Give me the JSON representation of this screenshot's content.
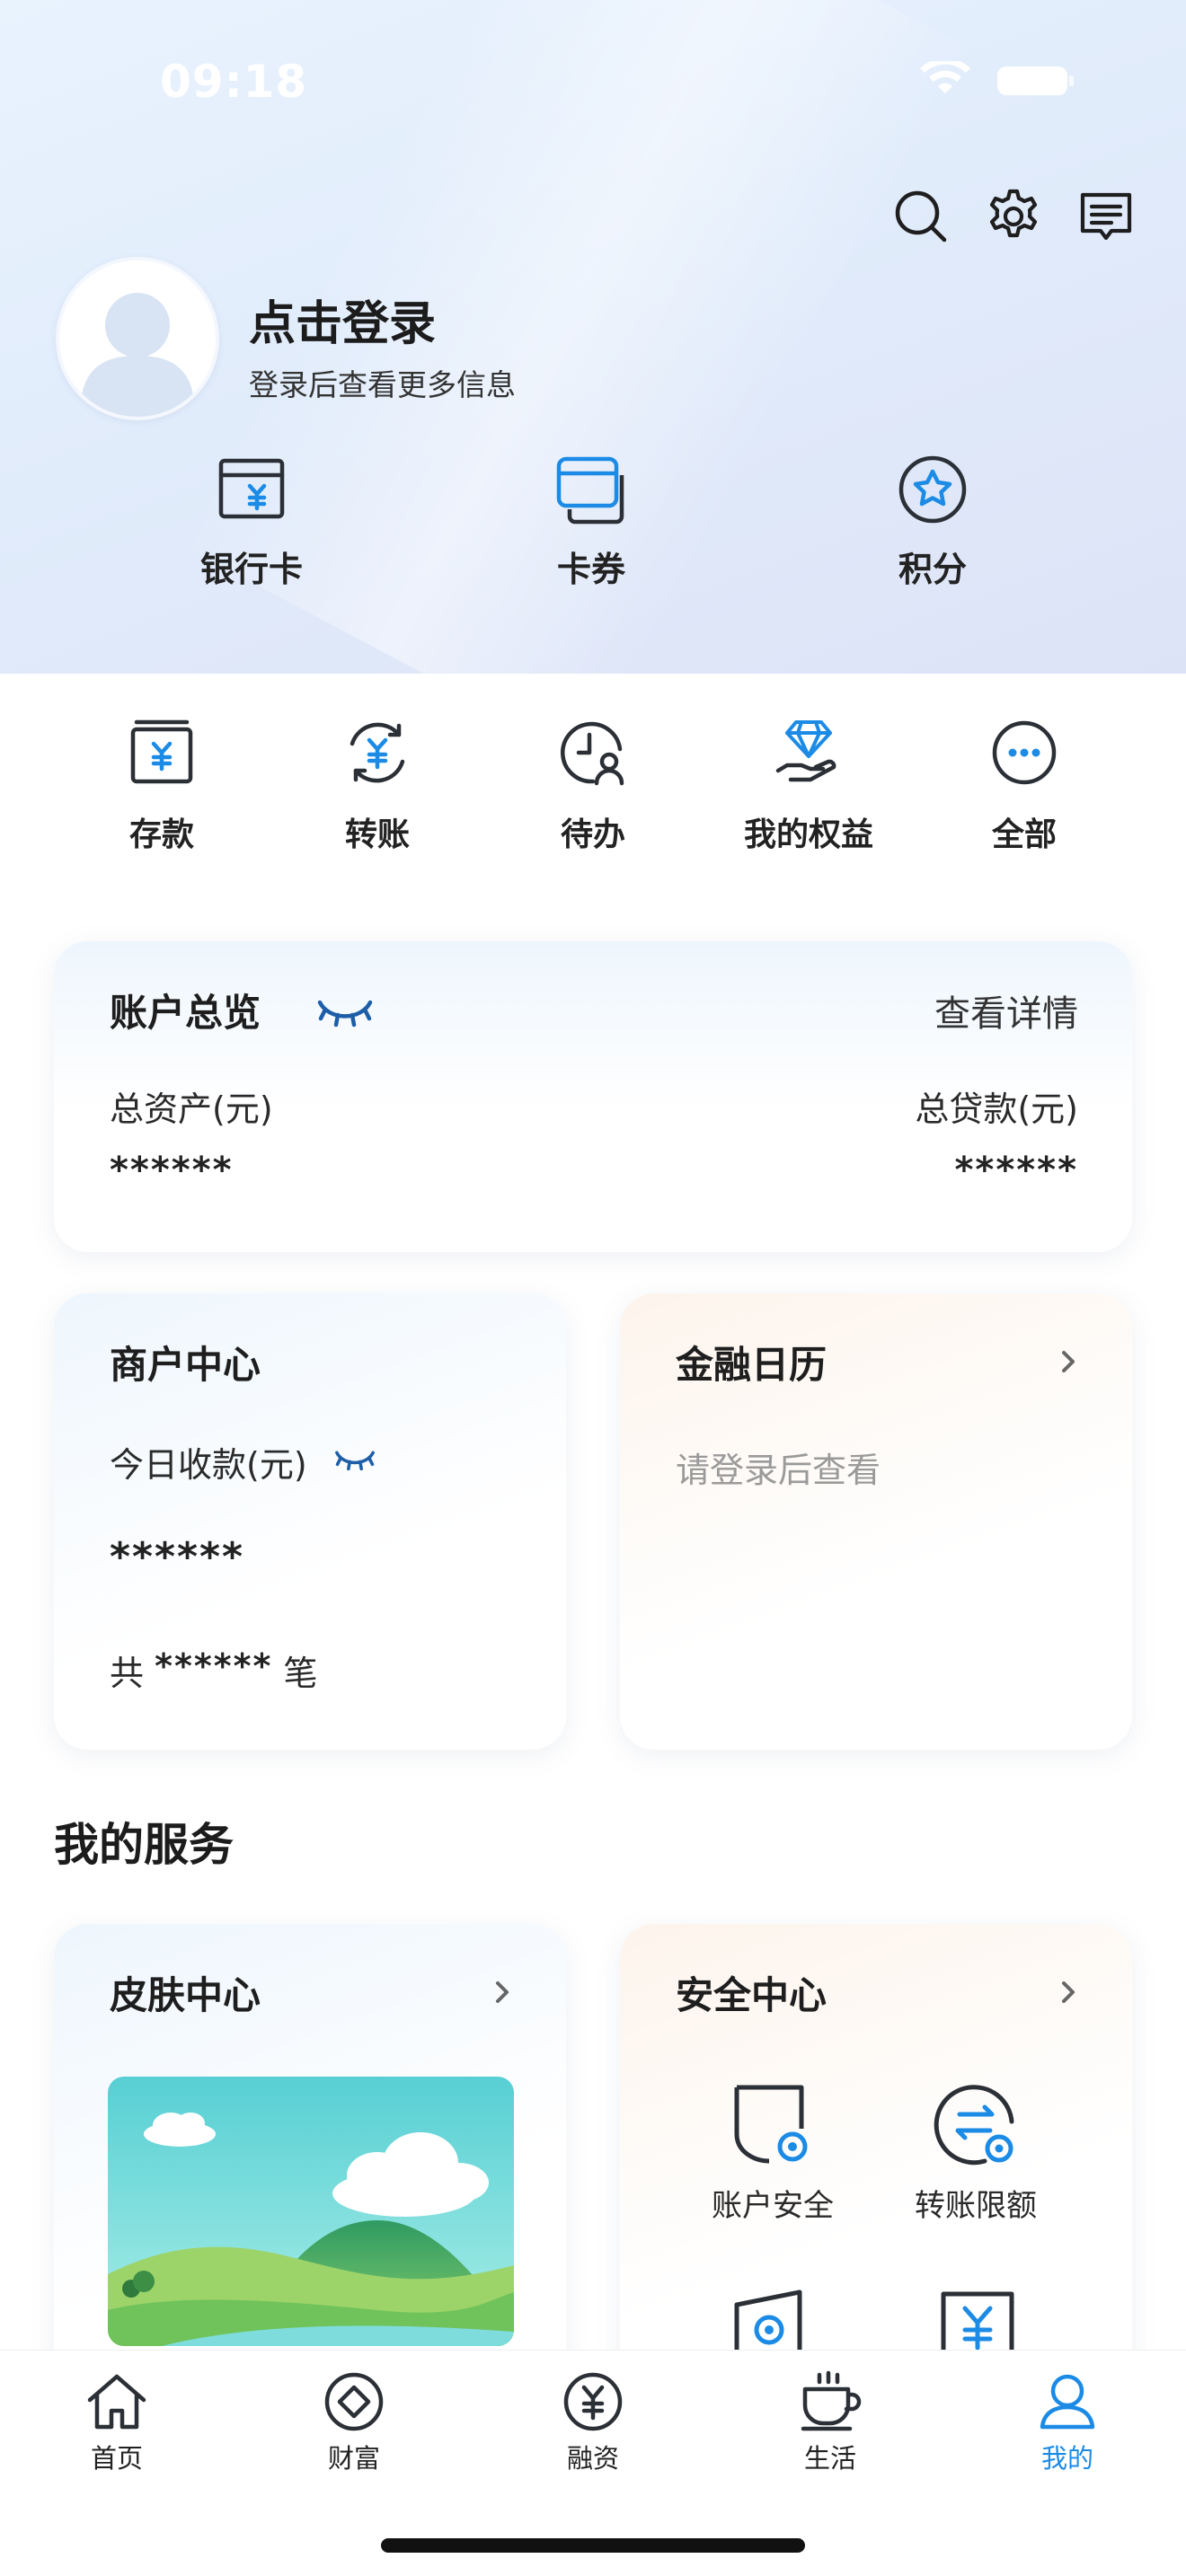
{
  "status_bar": {
    "time": "09:18"
  },
  "header": {
    "actions": [
      {
        "name": "search-icon"
      },
      {
        "name": "settings-icon"
      },
      {
        "name": "message-icon"
      }
    ],
    "profile": {
      "title": "点击登录",
      "subtitle": "登录后查看更多信息"
    },
    "shortcuts": [
      {
        "label": "银行卡",
        "icon": "bank-card-icon"
      },
      {
        "label": "卡券",
        "icon": "coupon-icon"
      },
      {
        "label": "积分",
        "icon": "points-star-icon"
      }
    ]
  },
  "quick_actions": [
    {
      "label": "存款",
      "icon": "deposit-icon"
    },
    {
      "label": "转账",
      "icon": "transfer-icon"
    },
    {
      "label": "待办",
      "icon": "todo-icon"
    },
    {
      "label": "我的权益",
      "icon": "benefits-diamond-icon"
    },
    {
      "label": "全部",
      "icon": "more-icon"
    }
  ],
  "account_overview": {
    "title": "账户总览",
    "detail_link": "查看详情",
    "total_assets_label": "总资产(元)",
    "total_assets_value": "******",
    "total_loans_label": "总贷款(元)",
    "total_loans_value": "******"
  },
  "merchant_center": {
    "title": "商户中心",
    "today_label": "今日收款(元)",
    "today_value": "******",
    "count_prefix": "共",
    "count_value": "******",
    "count_suffix": "笔"
  },
  "finance_calendar": {
    "title": "金融日历",
    "hint": "请登录后查看"
  },
  "my_services": {
    "section_title": "我的服务",
    "skin_center": {
      "title": "皮肤中心"
    },
    "security_center": {
      "title": "安全中心",
      "items": [
        {
          "label": "账户安全",
          "icon": "account-security-icon"
        },
        {
          "label": "转账限额",
          "icon": "transfer-limit-icon"
        }
      ]
    }
  },
  "tab_bar": {
    "tabs": [
      {
        "label": "首页",
        "icon": "home-icon",
        "active": false
      },
      {
        "label": "财富",
        "icon": "wealth-icon",
        "active": false
      },
      {
        "label": "融资",
        "icon": "financing-icon",
        "active": false
      },
      {
        "label": "生活",
        "icon": "life-cup-icon",
        "active": false
      },
      {
        "label": "我的",
        "icon": "profile-icon",
        "active": true
      }
    ],
    "active_color": "#1b8be6"
  },
  "colors": {
    "accent_blue": "#1b8be6",
    "icon_dark": "#2b2f36"
  }
}
